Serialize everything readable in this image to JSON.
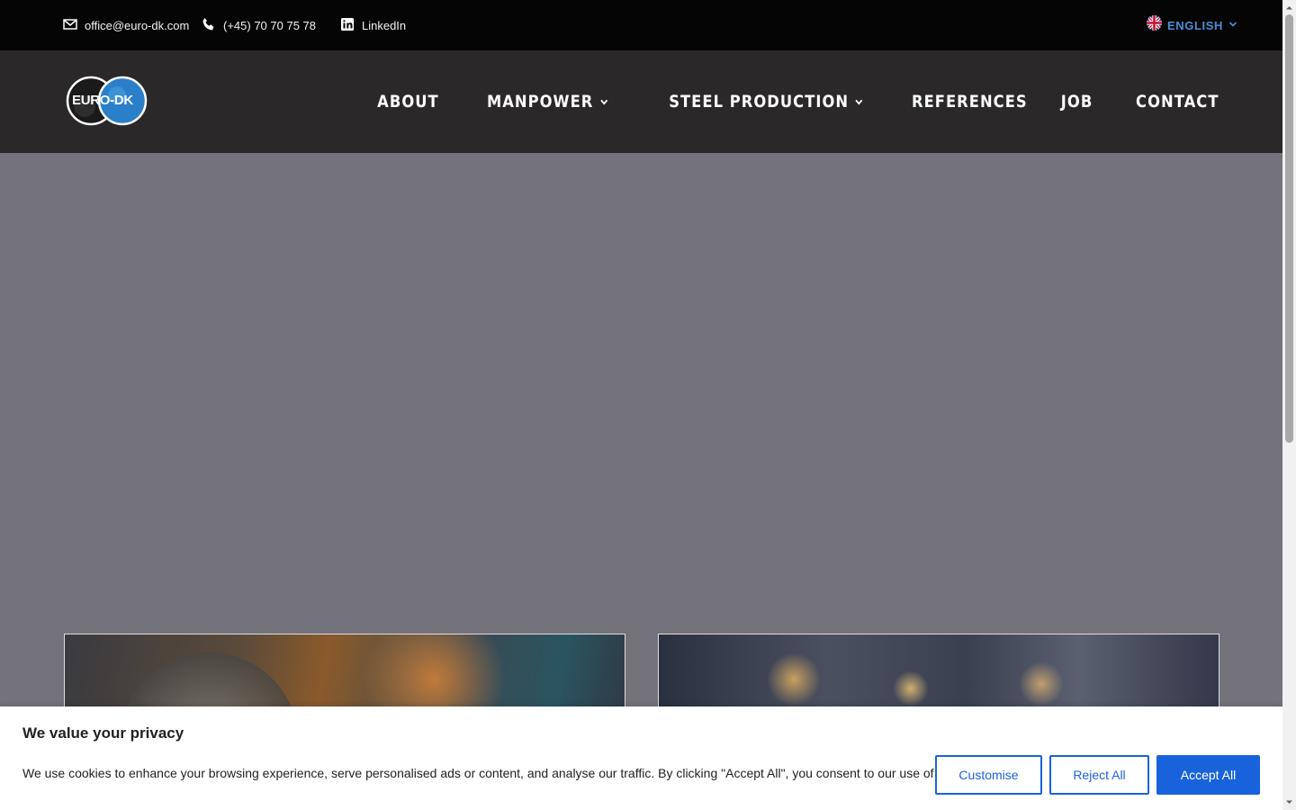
{
  "topbar": {
    "email": "office@euro-dk.com",
    "phone": "(+45) 70 70 75 78",
    "linkedin": "LinkedIn",
    "language": "ENGLISH"
  },
  "header": {
    "logo_text": "EURO-DK",
    "nav": [
      {
        "label": "ABOUT",
        "has_dropdown": false
      },
      {
        "label": "MANPOWER",
        "has_dropdown": true
      },
      {
        "label": "STEEL PRODUCTION",
        "has_dropdown": true
      },
      {
        "label": "REFERENCES",
        "has_dropdown": false
      },
      {
        "label": "JOB",
        "has_dropdown": false
      },
      {
        "label": "CONTACT",
        "has_dropdown": false
      }
    ]
  },
  "cookie": {
    "title": "We value your privacy",
    "text": "We use cookies to enhance your browsing experience, serve personalised ads or content, and analyse our traffic. By clicking \"Accept All\", you consent to our use of cookies.",
    "customise": "Customise",
    "reject": "Reject All",
    "accept": "Accept All"
  },
  "colors": {
    "topbar_bg": "#050505",
    "header_bg": "#2b2829",
    "hero_overlay": "#74727a",
    "language_accent": "#4a8fd6",
    "button_blue": "#1863dc"
  },
  "icons": [
    "envelope-icon",
    "phone-icon",
    "linkedin-icon",
    "uk-flag-icon",
    "chevron-down-icon"
  ]
}
